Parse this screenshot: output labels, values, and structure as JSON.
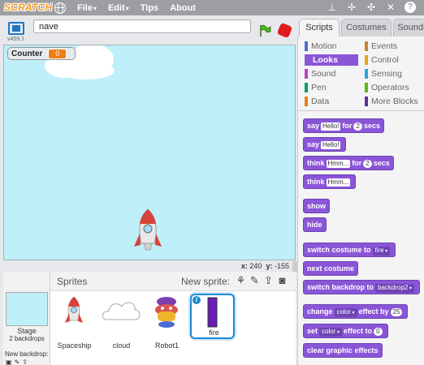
{
  "menubar": {
    "logo": "SCRATCH",
    "menus": [
      {
        "label": "File",
        "caret": "▾"
      },
      {
        "label": "Edit",
        "caret": "▾"
      },
      {
        "label": "Tips",
        "caret": ""
      },
      {
        "label": "About",
        "caret": ""
      }
    ],
    "tool_icons": [
      "stamp-icon",
      "cut-icon",
      "grow-icon",
      "shrink-icon",
      "help-icon"
    ]
  },
  "stage_header": {
    "version": "v459.1",
    "project_title": "nave"
  },
  "stage": {
    "variable_monitor": {
      "label": "Counter",
      "value": "0"
    }
  },
  "coords": {
    "x_label": "x:",
    "x": "240",
    "y_label": "y:",
    "y": "-155"
  },
  "sprites_pane": {
    "title": "Sprites",
    "new_sprite_label": "New sprite:",
    "stage_label": "Stage",
    "stage_sub": "2 backdrops",
    "new_backdrop_label": "New backdrop:",
    "sprites": [
      {
        "name": "Spaceship",
        "selected": false
      },
      {
        "name": "cloud",
        "selected": false
      },
      {
        "name": "Robot1",
        "selected": false
      },
      {
        "name": "fire",
        "selected": true
      }
    ]
  },
  "tabs": [
    {
      "label": "Scripts",
      "active": true
    },
    {
      "label": "Costumes",
      "active": false
    },
    {
      "label": "Sounds",
      "active": false
    }
  ],
  "categories": [
    {
      "label": "Motion",
      "color": "#4a6cd4",
      "active": false
    },
    {
      "label": "Events",
      "color": "#c88330",
      "active": false
    },
    {
      "label": "Looks",
      "color": "#8a55d7",
      "active": true
    },
    {
      "label": "Control",
      "color": "#e1a91a",
      "active": false
    },
    {
      "label": "Sound",
      "color": "#bb42c3",
      "active": false
    },
    {
      "label": "Sensing",
      "color": "#2ca5e2",
      "active": false
    },
    {
      "label": "Pen",
      "color": "#0e9a6c",
      "active": false
    },
    {
      "label": "Operators",
      "color": "#5cb712",
      "active": false
    },
    {
      "label": "Data",
      "color": "#ee7d16",
      "active": false
    },
    {
      "label": "More Blocks",
      "color": "#632d99",
      "active": false
    }
  ],
  "blocks": {
    "say_for": {
      "a": "say",
      "in1": "Hello!",
      "b": "for",
      "num": "2",
      "c": "secs"
    },
    "say": {
      "a": "say",
      "in1": "Hello!"
    },
    "think_for": {
      "a": "think",
      "in1": "Hmm...",
      "b": "for",
      "num": "2",
      "c": "secs"
    },
    "think": {
      "a": "think",
      "in1": "Hmm..."
    },
    "show": "show",
    "hide": "hide",
    "switch_costume": {
      "a": "switch costume to",
      "dd": "fire"
    },
    "next_costume": "next costume",
    "switch_backdrop": {
      "a": "switch backdrop to",
      "dd": "backdrop2"
    },
    "change_effect": {
      "a": "change",
      "dd": "color",
      "b": "effect by",
      "num": "25"
    },
    "set_effect": {
      "a": "set",
      "dd": "color",
      "b": "effect to",
      "num": "0"
    },
    "clear_effects": "clear graphic effects"
  }
}
